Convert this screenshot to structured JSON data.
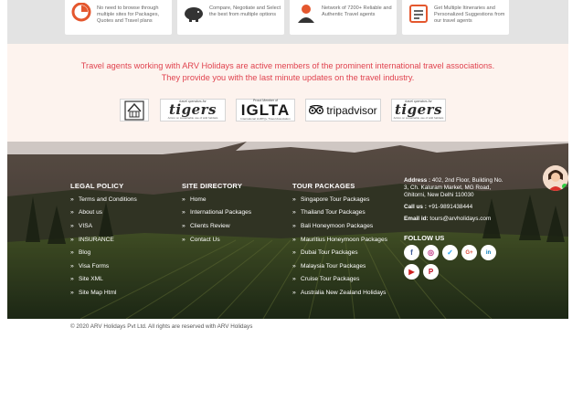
{
  "features": [
    {
      "icon": "timer-icon",
      "text": "No need to browse through multiple sites for Packages, Quotes and Travel plans"
    },
    {
      "icon": "piggy-bank-icon",
      "text": "Compare, Negotiate and Select the best from multiple options"
    },
    {
      "icon": "travel-agent-icon",
      "text": "Network of 7200+ Reliable and Authentic Travel agents"
    },
    {
      "icon": "itinerary-icon",
      "text": "Get Multiple Itineraries and Personalized Suggestions from our travel agents"
    }
  ],
  "associations": {
    "line1": "Travel agents working with ARV Holidays are active members of the prominent international travel associations.",
    "line2": "They provide you with the last minute updates on the travel industry.",
    "logos": {
      "tigers_top": "travel operators for",
      "tigers_main": "tigers",
      "tigers_sub": "Action on sustainable use of wild habitats",
      "iglta_top": "Proud Member of",
      "iglta_main": "IGLTA",
      "iglta_sub": "International LGBTQ+ Travel Association",
      "tripadvisor": "tripadvisor"
    }
  },
  "footer": {
    "legal_policy": {
      "title": "LEGAL POLICY",
      "items": [
        "Terms and Conditions",
        "About us",
        "VISA",
        "INSURANCE",
        "Blog",
        "Visa Forms",
        "Site XML",
        "Site Map Html"
      ]
    },
    "site_directory": {
      "title": "SITE DIRECTORY",
      "items": [
        "Home",
        "International Packages",
        "Clients Review",
        "Contact Us"
      ]
    },
    "tour_packages": {
      "title": "TOUR PACKAGES",
      "items": [
        "Singapore Tour Packages",
        "Thailand Tour Packages",
        "Bali Honeymoon Packages",
        "Mauritius Honeymoon Packages",
        "Dubai Tour Packages",
        "Malaysia Tour Packages",
        "Cruise Tour Packages",
        "Australia New Zealand Holidays"
      ]
    },
    "contact": {
      "address_label": "Address :",
      "address": "402, 2nd Floor, Building No. 3, Ch. Kaluram Market, MG Road, Ghitorni, New Delhi 110030",
      "call_label": "Call us :",
      "phone": "+91-9891438444",
      "email_label": "Email id:",
      "email": "tours@arvholidays.com"
    },
    "follow_title": "FOLLOW US",
    "social": [
      {
        "name": "facebook",
        "glyph": "f",
        "color": "#3b5998"
      },
      {
        "name": "instagram",
        "glyph": "◎",
        "color": "#c13584"
      },
      {
        "name": "twitter",
        "glyph": "✓",
        "color": "#1da1f2"
      },
      {
        "name": "google-plus",
        "glyph": "G+",
        "color": "#dd4b39"
      },
      {
        "name": "linkedin",
        "glyph": "in",
        "color": "#0077b5"
      },
      {
        "name": "youtube",
        "glyph": "▶",
        "color": "#cd201f"
      },
      {
        "name": "pinterest",
        "glyph": "P",
        "color": "#bd081c"
      }
    ]
  },
  "copyright": "© 2020 ARV Holidays Pvt Ltd. All rights are reserved with ARV Holidays"
}
